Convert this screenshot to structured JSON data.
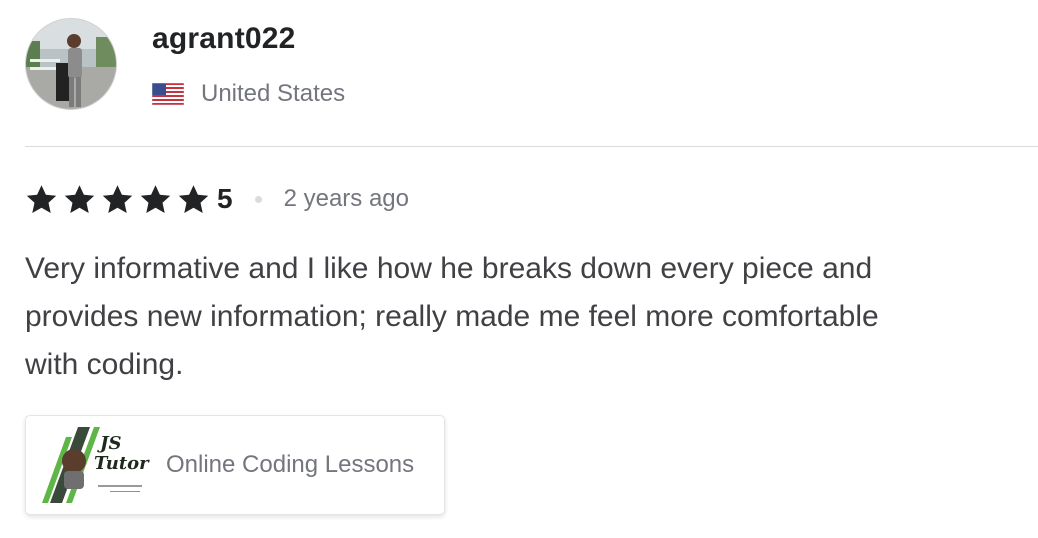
{
  "reviewer": {
    "username": "agrant022",
    "country": "United States",
    "flag_icon": "us-flag-icon"
  },
  "review": {
    "rating": "5",
    "star_icon": "star-icon",
    "time_ago": "2 years ago",
    "text": "Very informative and I like how he breaks down every piece and provides new information; really made me feel more comfortable with coding."
  },
  "gig": {
    "logo_text_line1": "JS",
    "logo_text_line2": "Tutor",
    "title": "Online Coding Lessons"
  },
  "colors": {
    "text_primary": "#222325",
    "text_secondary": "#74767e",
    "divider": "#dadbdd",
    "accent_green": "#5fb547"
  }
}
